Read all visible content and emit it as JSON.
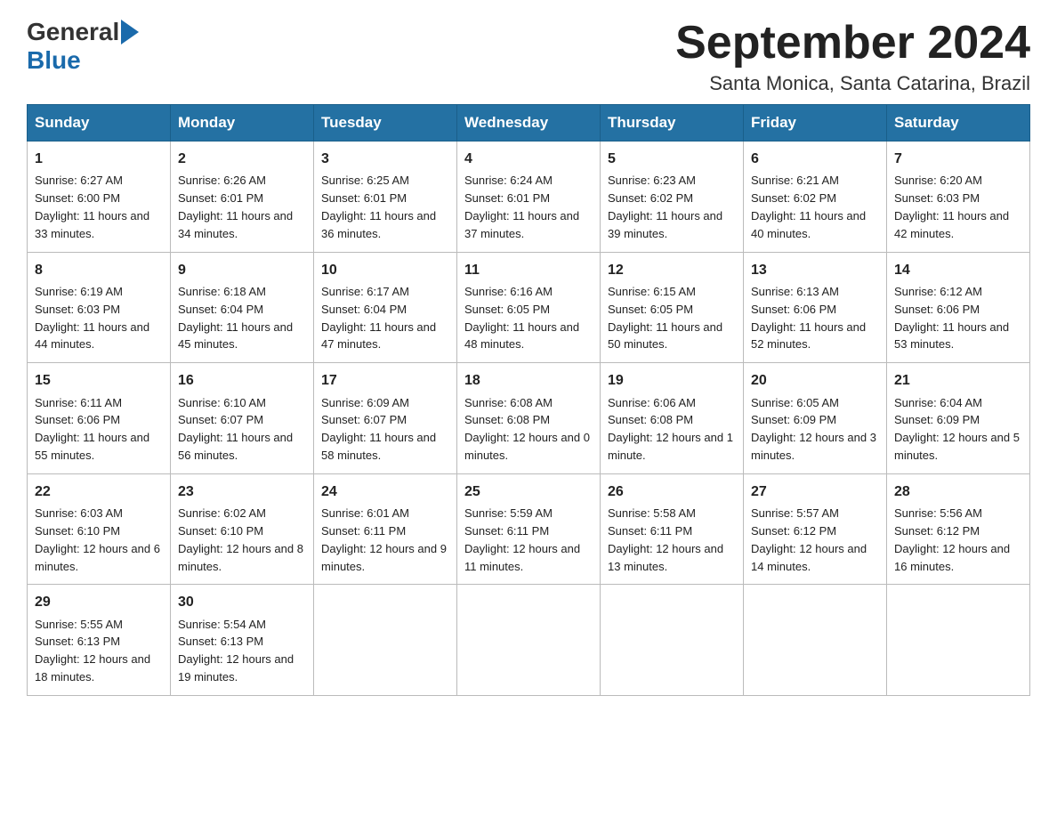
{
  "header": {
    "logo_general": "General",
    "logo_blue": "Blue",
    "month_title": "September 2024",
    "subtitle": "Santa Monica, Santa Catarina, Brazil"
  },
  "weekdays": [
    "Sunday",
    "Monday",
    "Tuesday",
    "Wednesday",
    "Thursday",
    "Friday",
    "Saturday"
  ],
  "weeks": [
    [
      {
        "day": "1",
        "sunrise": "Sunrise: 6:27 AM",
        "sunset": "Sunset: 6:00 PM",
        "daylight": "Daylight: 11 hours and 33 minutes."
      },
      {
        "day": "2",
        "sunrise": "Sunrise: 6:26 AM",
        "sunset": "Sunset: 6:01 PM",
        "daylight": "Daylight: 11 hours and 34 minutes."
      },
      {
        "day": "3",
        "sunrise": "Sunrise: 6:25 AM",
        "sunset": "Sunset: 6:01 PM",
        "daylight": "Daylight: 11 hours and 36 minutes."
      },
      {
        "day": "4",
        "sunrise": "Sunrise: 6:24 AM",
        "sunset": "Sunset: 6:01 PM",
        "daylight": "Daylight: 11 hours and 37 minutes."
      },
      {
        "day": "5",
        "sunrise": "Sunrise: 6:23 AM",
        "sunset": "Sunset: 6:02 PM",
        "daylight": "Daylight: 11 hours and 39 minutes."
      },
      {
        "day": "6",
        "sunrise": "Sunrise: 6:21 AM",
        "sunset": "Sunset: 6:02 PM",
        "daylight": "Daylight: 11 hours and 40 minutes."
      },
      {
        "day": "7",
        "sunrise": "Sunrise: 6:20 AM",
        "sunset": "Sunset: 6:03 PM",
        "daylight": "Daylight: 11 hours and 42 minutes."
      }
    ],
    [
      {
        "day": "8",
        "sunrise": "Sunrise: 6:19 AM",
        "sunset": "Sunset: 6:03 PM",
        "daylight": "Daylight: 11 hours and 44 minutes."
      },
      {
        "day": "9",
        "sunrise": "Sunrise: 6:18 AM",
        "sunset": "Sunset: 6:04 PM",
        "daylight": "Daylight: 11 hours and 45 minutes."
      },
      {
        "day": "10",
        "sunrise": "Sunrise: 6:17 AM",
        "sunset": "Sunset: 6:04 PM",
        "daylight": "Daylight: 11 hours and 47 minutes."
      },
      {
        "day": "11",
        "sunrise": "Sunrise: 6:16 AM",
        "sunset": "Sunset: 6:05 PM",
        "daylight": "Daylight: 11 hours and 48 minutes."
      },
      {
        "day": "12",
        "sunrise": "Sunrise: 6:15 AM",
        "sunset": "Sunset: 6:05 PM",
        "daylight": "Daylight: 11 hours and 50 minutes."
      },
      {
        "day": "13",
        "sunrise": "Sunrise: 6:13 AM",
        "sunset": "Sunset: 6:06 PM",
        "daylight": "Daylight: 11 hours and 52 minutes."
      },
      {
        "day": "14",
        "sunrise": "Sunrise: 6:12 AM",
        "sunset": "Sunset: 6:06 PM",
        "daylight": "Daylight: 11 hours and 53 minutes."
      }
    ],
    [
      {
        "day": "15",
        "sunrise": "Sunrise: 6:11 AM",
        "sunset": "Sunset: 6:06 PM",
        "daylight": "Daylight: 11 hours and 55 minutes."
      },
      {
        "day": "16",
        "sunrise": "Sunrise: 6:10 AM",
        "sunset": "Sunset: 6:07 PM",
        "daylight": "Daylight: 11 hours and 56 minutes."
      },
      {
        "day": "17",
        "sunrise": "Sunrise: 6:09 AM",
        "sunset": "Sunset: 6:07 PM",
        "daylight": "Daylight: 11 hours and 58 minutes."
      },
      {
        "day": "18",
        "sunrise": "Sunrise: 6:08 AM",
        "sunset": "Sunset: 6:08 PM",
        "daylight": "Daylight: 12 hours and 0 minutes."
      },
      {
        "day": "19",
        "sunrise": "Sunrise: 6:06 AM",
        "sunset": "Sunset: 6:08 PM",
        "daylight": "Daylight: 12 hours and 1 minute."
      },
      {
        "day": "20",
        "sunrise": "Sunrise: 6:05 AM",
        "sunset": "Sunset: 6:09 PM",
        "daylight": "Daylight: 12 hours and 3 minutes."
      },
      {
        "day": "21",
        "sunrise": "Sunrise: 6:04 AM",
        "sunset": "Sunset: 6:09 PM",
        "daylight": "Daylight: 12 hours and 5 minutes."
      }
    ],
    [
      {
        "day": "22",
        "sunrise": "Sunrise: 6:03 AM",
        "sunset": "Sunset: 6:10 PM",
        "daylight": "Daylight: 12 hours and 6 minutes."
      },
      {
        "day": "23",
        "sunrise": "Sunrise: 6:02 AM",
        "sunset": "Sunset: 6:10 PM",
        "daylight": "Daylight: 12 hours and 8 minutes."
      },
      {
        "day": "24",
        "sunrise": "Sunrise: 6:01 AM",
        "sunset": "Sunset: 6:11 PM",
        "daylight": "Daylight: 12 hours and 9 minutes."
      },
      {
        "day": "25",
        "sunrise": "Sunrise: 5:59 AM",
        "sunset": "Sunset: 6:11 PM",
        "daylight": "Daylight: 12 hours and 11 minutes."
      },
      {
        "day": "26",
        "sunrise": "Sunrise: 5:58 AM",
        "sunset": "Sunset: 6:11 PM",
        "daylight": "Daylight: 12 hours and 13 minutes."
      },
      {
        "day": "27",
        "sunrise": "Sunrise: 5:57 AM",
        "sunset": "Sunset: 6:12 PM",
        "daylight": "Daylight: 12 hours and 14 minutes."
      },
      {
        "day": "28",
        "sunrise": "Sunrise: 5:56 AM",
        "sunset": "Sunset: 6:12 PM",
        "daylight": "Daylight: 12 hours and 16 minutes."
      }
    ],
    [
      {
        "day": "29",
        "sunrise": "Sunrise: 5:55 AM",
        "sunset": "Sunset: 6:13 PM",
        "daylight": "Daylight: 12 hours and 18 minutes."
      },
      {
        "day": "30",
        "sunrise": "Sunrise: 5:54 AM",
        "sunset": "Sunset: 6:13 PM",
        "daylight": "Daylight: 12 hours and 19 minutes."
      },
      null,
      null,
      null,
      null,
      null
    ]
  ]
}
